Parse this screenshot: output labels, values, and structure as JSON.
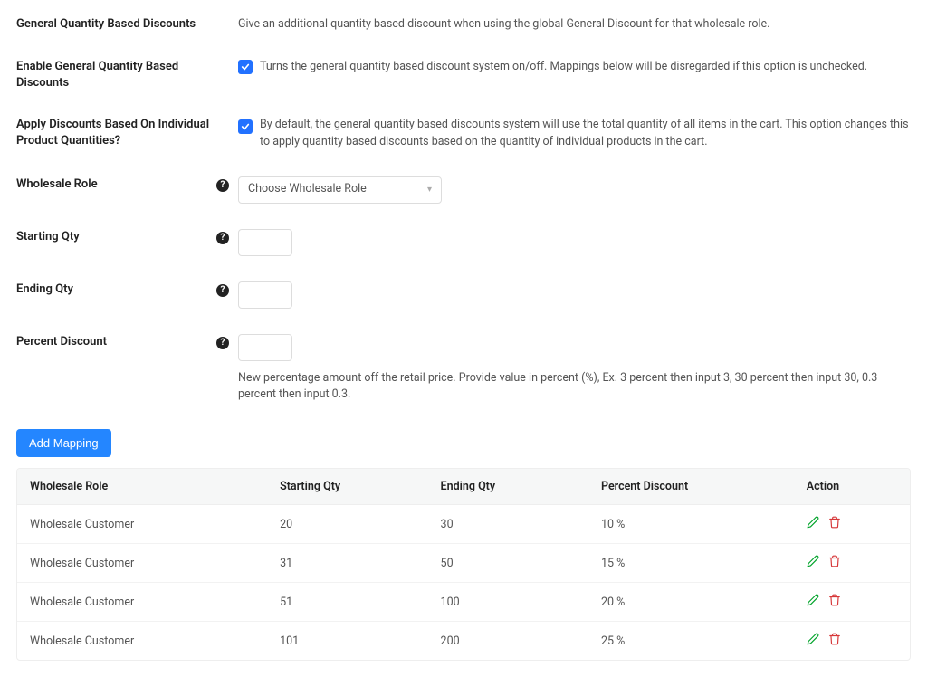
{
  "header": {
    "title": "General Quantity Based Discounts",
    "description": "Give an additional quantity based discount when using the global General Discount for that wholesale role."
  },
  "enable": {
    "label": "Enable General Quantity Based Discounts",
    "description": "Turns the general quantity based discount system on/off. Mappings below will be disregarded if this option is unchecked."
  },
  "individual": {
    "label": "Apply Discounts Based On Individual Product Quantities?",
    "description": "By default, the general quantity based discounts system will use the total quantity of all items in the cart. This option changes this to apply quantity based discounts based on the quantity of individual products in the cart."
  },
  "role": {
    "label": "Wholesale Role",
    "placeholder": "Choose Wholesale Role"
  },
  "start_qty": {
    "label": "Starting Qty"
  },
  "end_qty": {
    "label": "Ending Qty"
  },
  "percent": {
    "label": "Percent Discount",
    "hint": "New percentage amount off the retail price. Provide value in percent (%), Ex. 3 percent then input 3, 30 percent then input 30, 0.3 percent then input 0.3."
  },
  "add_mapping_label": "Add Mapping",
  "table": {
    "columns": {
      "role": "Wholesale Role",
      "start": "Starting Qty",
      "end": "Ending Qty",
      "discount": "Percent Discount",
      "action": "Action"
    },
    "rows": [
      {
        "role": "Wholesale Customer",
        "start": "20",
        "end": "30",
        "discount": "10 %"
      },
      {
        "role": "Wholesale Customer",
        "start": "31",
        "end": "50",
        "discount": "15 %"
      },
      {
        "role": "Wholesale Customer",
        "start": "51",
        "end": "100",
        "discount": "20 %"
      },
      {
        "role": "Wholesale Customer",
        "start": "101",
        "end": "200",
        "discount": "25 %"
      }
    ]
  }
}
